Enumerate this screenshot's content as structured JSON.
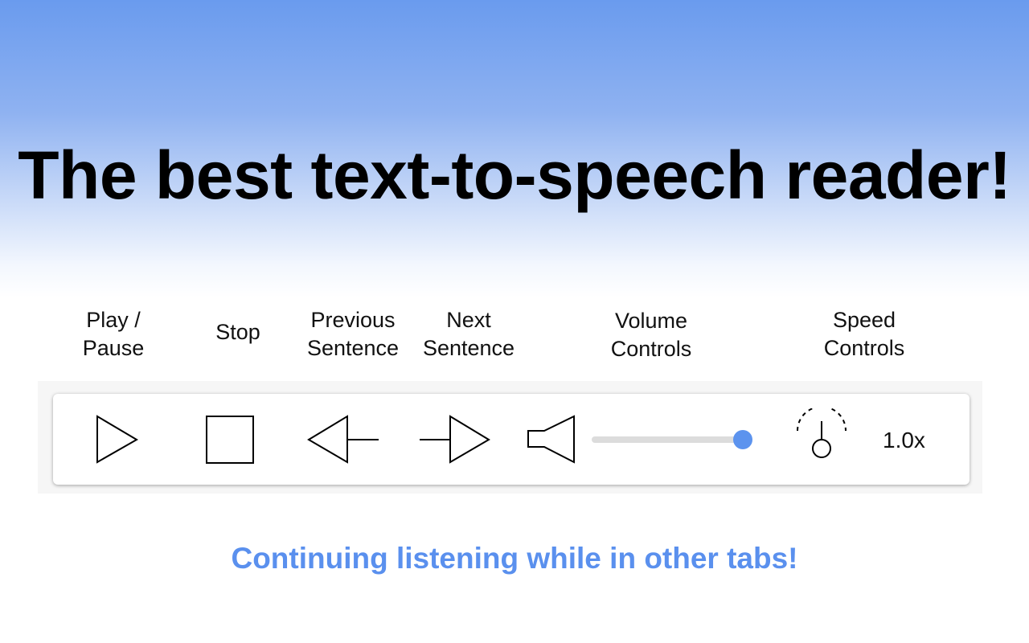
{
  "hero": {
    "title": "The best text-to-speech reader!"
  },
  "labels": {
    "play_pause": "Play /\nPause",
    "stop": "Stop",
    "previous": "Previous\nSentence",
    "next": "Next\nSentence",
    "volume": "Volume\nControls",
    "speed": "Speed\nControls"
  },
  "controls": {
    "play_icon": "play-triangle",
    "stop_icon": "stop-square",
    "previous_icon": "previous-sentence-arrow",
    "next_icon": "next-sentence-arrow",
    "volume_icon": "speaker",
    "volume_level": 1.0,
    "speed_icon": "speed-gauge",
    "speed_value": "1.0x"
  },
  "colors": {
    "accent": "#5a90ee",
    "slider_thumb": "#5c93ee",
    "slider_track": "#dcdcdc",
    "gradient_top": "#6a9bee"
  },
  "tagline": {
    "text": "Continuing listening while in other tabs!"
  }
}
